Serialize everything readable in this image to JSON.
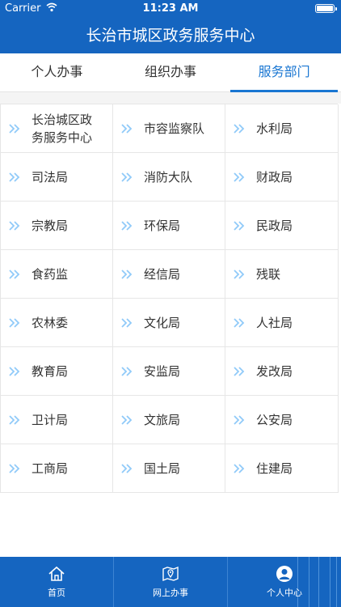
{
  "status_bar": {
    "carrier": "Carrier",
    "time": "11:23 AM"
  },
  "nav": {
    "title": "长治市城区政务服务中心"
  },
  "tabs": [
    {
      "label": "个人办事",
      "active": false
    },
    {
      "label": "组织办事",
      "active": false
    },
    {
      "label": "服务部门",
      "active": true
    }
  ],
  "departments": [
    [
      "长治城区政务服务中心",
      "市容监察队",
      "水利局"
    ],
    [
      "司法局",
      "消防大队",
      "财政局"
    ],
    [
      "宗教局",
      "环保局",
      "民政局"
    ],
    [
      "食药监",
      "经信局",
      "残联"
    ],
    [
      "农林委",
      "文化局",
      "人社局"
    ],
    [
      "教育局",
      "安监局",
      "发改局"
    ],
    [
      "卫计局",
      "文旅局",
      "公安局"
    ],
    [
      "工商局",
      "国土局",
      "住建局"
    ]
  ],
  "bottom_nav": [
    {
      "label": "首页",
      "icon": "home-icon"
    },
    {
      "label": "网上办事",
      "icon": "map-pin-icon"
    },
    {
      "label": "个人中心",
      "icon": "user-icon"
    }
  ],
  "colors": {
    "primary": "#1565c0",
    "accent": "#1976d2",
    "chevron": "#90caf9"
  }
}
